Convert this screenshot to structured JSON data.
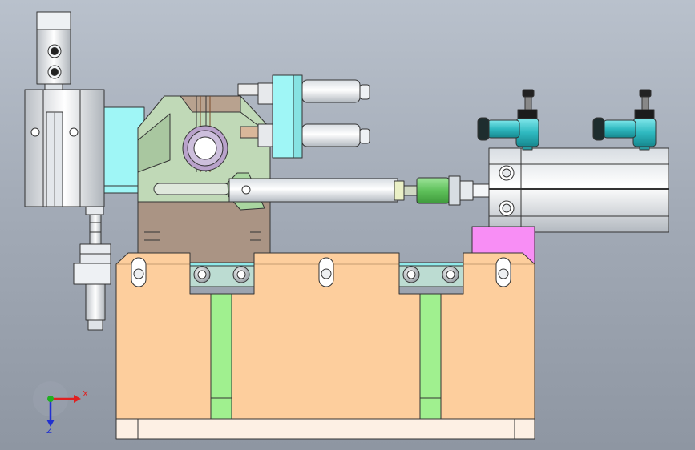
{
  "triad": {
    "x_label": "X",
    "z_label": "Z"
  },
  "colors": {
    "background_top": "#b9c1cc",
    "background_bottom": "#8e96a2",
    "base_body": "#fdce9d",
    "base_foot": "#fdf0e4",
    "rib": "#a0f08f",
    "clamp_bracket": "#c0d9b7",
    "bracket_pad": "#aa9484",
    "cyan_mount": "#9ff6f6",
    "cylinder_body": "#fafcfd",
    "pink_spacer": "#f88ef5",
    "pivot_ring": "#b9a2cb",
    "fitting": "#28bdc3",
    "coupling": "#7fd57a",
    "axis_x": "#e02020",
    "axis_y": "#20b020",
    "axis_z": "#2030d0"
  }
}
